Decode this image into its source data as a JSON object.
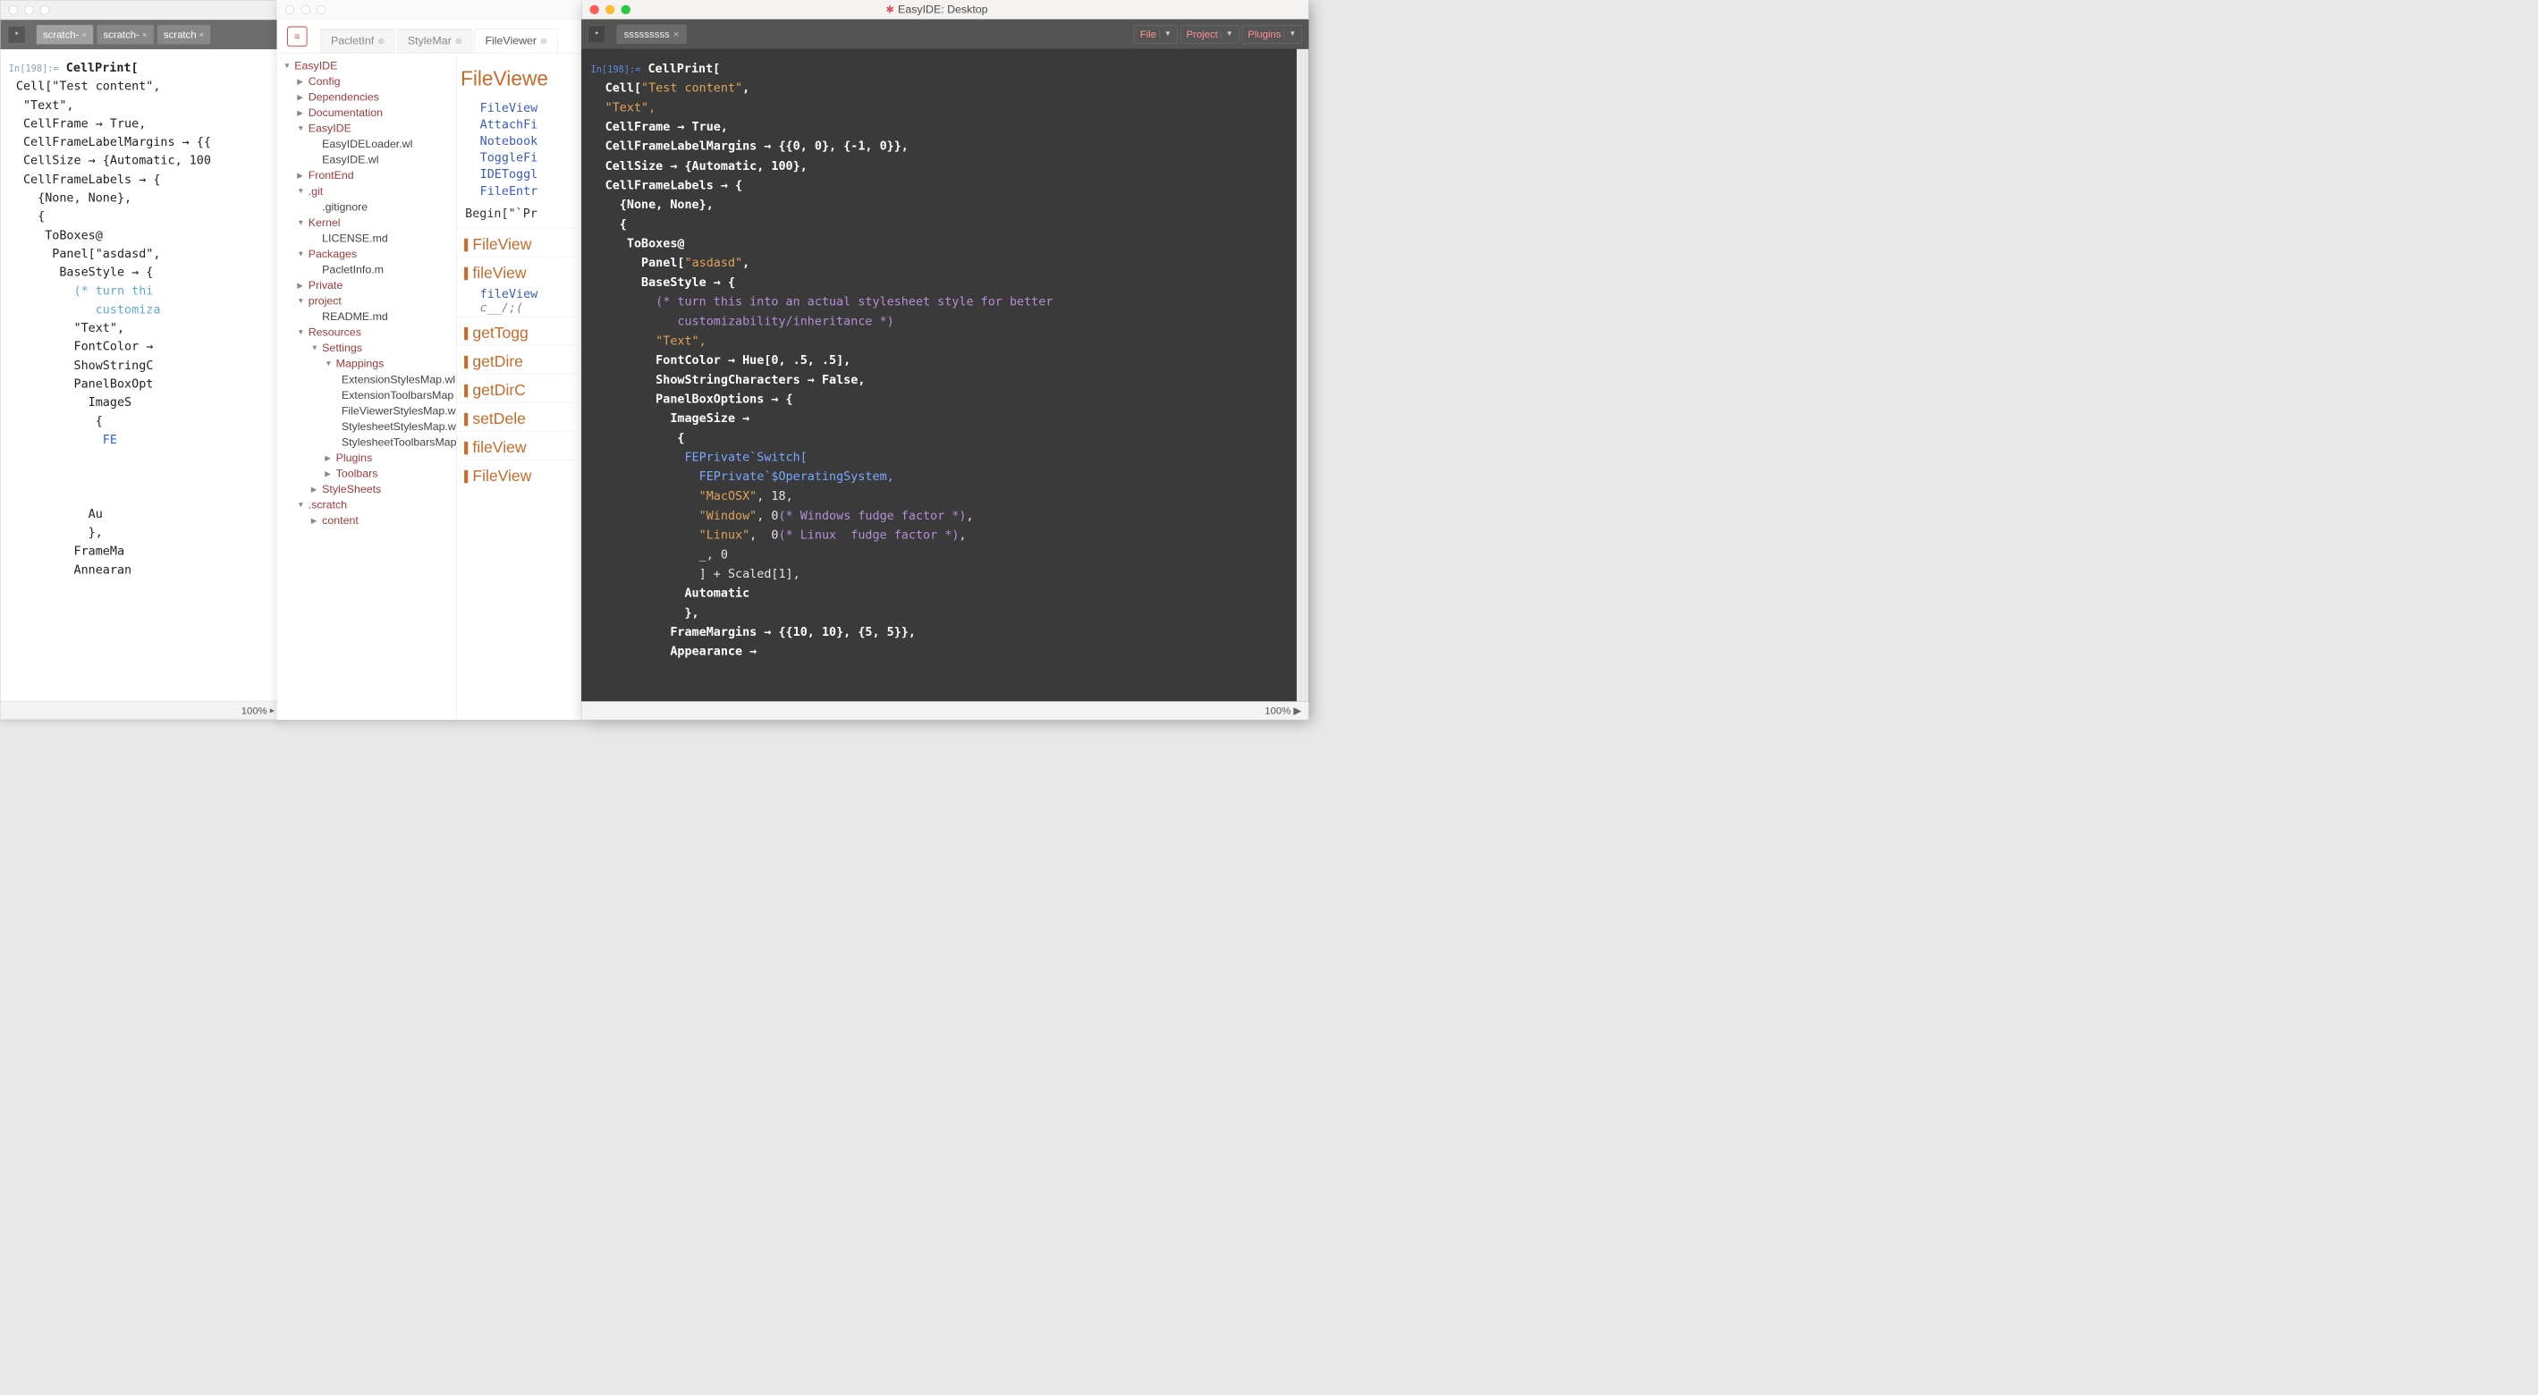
{
  "wLeft": {
    "badge": "*",
    "tabs": [
      {
        "label": "scratch-",
        "active": true
      },
      {
        "label": "scratch-",
        "active": false
      },
      {
        "label": "scratch",
        "active": false
      }
    ],
    "inLabel": "In[198]:=",
    "code": {
      "l1": "CellPrint[",
      "l2": " Cell[\"Test content\",",
      "l3": "  \"Text\",",
      "l4": "  CellFrame → True,",
      "l5": "  CellFrameLabelMargins → {{",
      "l6": "  CellSize → {Automatic, 100",
      "l7": "  CellFrameLabels → {",
      "l8": "    {None, None},",
      "l9": "    {",
      "l10": "     ToBoxes@",
      "l11": "      Panel[\"asdasd\",",
      "l12": "       BaseStyle → {",
      "l13a": "         (* turn thi",
      "l13b": "            customiza",
      "l14": "         \"Text\",",
      "l15": "         FontColor →",
      "l16": "         ShowStringC",
      "l17": "         PanelBoxOpt",
      "l18": "           ImageS",
      "l19": "            {",
      "l20": "             FE",
      "l21": "           Au",
      "l22": "           },",
      "l23": "         FrameMa",
      "l24": "         Annearan"
    },
    "zoom": "100%"
  },
  "wMid": {
    "menuGlyph": "≡",
    "tabs": [
      {
        "label": "PacletInf",
        "active": false
      },
      {
        "label": "StyleMar",
        "active": false
      },
      {
        "label": "FileViewer",
        "active": true
      }
    ],
    "treeRoot": "EasyIDE",
    "tree": [
      {
        "d": 1,
        "t": "f",
        "open": false,
        "label": "Config"
      },
      {
        "d": 1,
        "t": "f",
        "open": false,
        "label": "Dependencies"
      },
      {
        "d": 1,
        "t": "f",
        "open": false,
        "label": "Documentation"
      },
      {
        "d": 1,
        "t": "f",
        "open": true,
        "label": "EasyIDE"
      },
      {
        "d": 2,
        "t": "x",
        "label": "EasyIDELoader.wl"
      },
      {
        "d": 2,
        "t": "x",
        "label": "EasyIDE.wl"
      },
      {
        "d": 1,
        "t": "f",
        "open": false,
        "label": "FrontEnd"
      },
      {
        "d": 1,
        "t": "f",
        "open": true,
        "label": ".git"
      },
      {
        "d": 2,
        "t": "x",
        "label": ".gitignore"
      },
      {
        "d": 1,
        "t": "f",
        "open": true,
        "label": "Kernel"
      },
      {
        "d": 2,
        "t": "x",
        "label": "LICENSE.md"
      },
      {
        "d": 1,
        "t": "f",
        "open": true,
        "label": "Packages"
      },
      {
        "d": 2,
        "t": "x",
        "label": "PacletInfo.m"
      },
      {
        "d": 1,
        "t": "f",
        "open": false,
        "label": "Private"
      },
      {
        "d": 1,
        "t": "f",
        "open": true,
        "label": "project"
      },
      {
        "d": 2,
        "t": "x",
        "label": "README.md"
      },
      {
        "d": 1,
        "t": "f",
        "open": true,
        "label": "Resources"
      },
      {
        "d": 2,
        "t": "f",
        "open": true,
        "label": "Settings"
      },
      {
        "d": 3,
        "t": "f",
        "open": true,
        "label": "Mappings"
      },
      {
        "d": 4,
        "t": "x",
        "label": "ExtensionStylesMap.wl"
      },
      {
        "d": 4,
        "t": "x",
        "label": "ExtensionToolbarsMap"
      },
      {
        "d": 4,
        "t": "x",
        "label": "FileViewerStylesMap.w"
      },
      {
        "d": 4,
        "t": "x",
        "label": "StylesheetStylesMap.w"
      },
      {
        "d": 4,
        "t": "x",
        "label": "StylesheetToolbarsMap"
      },
      {
        "d": 3,
        "t": "f",
        "open": false,
        "label": "Plugins"
      },
      {
        "d": 3,
        "t": "f",
        "open": false,
        "label": "Toolbars"
      },
      {
        "d": 2,
        "t": "f",
        "open": false,
        "label": "StyleSheets"
      },
      {
        "d": 1,
        "t": "f",
        "open": true,
        "label": ".scratch"
      },
      {
        "d": 2,
        "t": "f",
        "open": false,
        "label": "content"
      }
    ],
    "doc": {
      "title": "FileViewe",
      "links": [
        "FileView",
        "AttachFi",
        "Notebook",
        "ToggleFi",
        "IDEToggl",
        "FileEntr"
      ],
      "begin": "Begin[\"`Pr",
      "sections": [
        {
          "h": "FileView"
        },
        {
          "h": "fileView",
          "sub": "fileView",
          "args": "c__/;("
        },
        {
          "h": "getTogg"
        },
        {
          "h": "getDire"
        },
        {
          "h": "getDirC"
        },
        {
          "h": "setDele"
        },
        {
          "h": "fileView"
        },
        {
          "h": "FileView"
        }
      ]
    }
  },
  "wRight": {
    "title": "EasyIDE: Desktop",
    "badge": "*",
    "tab": "sssssssss",
    "menus": [
      "File",
      "Project",
      "Plugins"
    ],
    "inLabel": "In[198]:=",
    "code": {
      "l1": "CellPrint[",
      "l2": " Cell[\"Test content\",",
      "l3": "  \"Text\",",
      "l4": "  CellFrame → True,",
      "l5": "  CellFrameLabelMargins → {{0, 0}, {-1, 0}},",
      "l6": "  CellSize → {Automatic, 100},",
      "l7": "  CellFrameLabels → {",
      "l8": "    {None, None},",
      "l9": "    {",
      "l10": "     ToBoxes@",
      "l11": "      Panel[\"asdasd\",",
      "l12": "       BaseStyle → {",
      "l13a": "         (* turn this into an actual stylesheet style for better",
      "l13b": "            customizability/inheritance *)",
      "l14": "         \"Text\",",
      "l15": "         FontColor → Hue[0, .5, .5],",
      "l16": "         ShowStringCharacters → False,",
      "l17": "         PanelBoxOptions → {",
      "l18": "           ImageSize →",
      "l19": "            {",
      "l20": "             FEPrivate`Switch[",
      "l21": "               FEPrivate`$OperatingSystem,",
      "l22a": "               \"MacOSX\", 18,",
      "l22b": "               \"Window\", 0(* Windows fudge factor *),",
      "l22c": "               \"Linux\",  0(* Linux  fudge factor *),",
      "l23": "               _, 0",
      "l24": "               ] + Scaled[1],",
      "l25": "             Automatic",
      "l26": "             },",
      "l27": "           FrameMargins → {{10, 10}, {5, 5}},",
      "l28": "           Appearance →"
    },
    "zoom": "100%"
  }
}
